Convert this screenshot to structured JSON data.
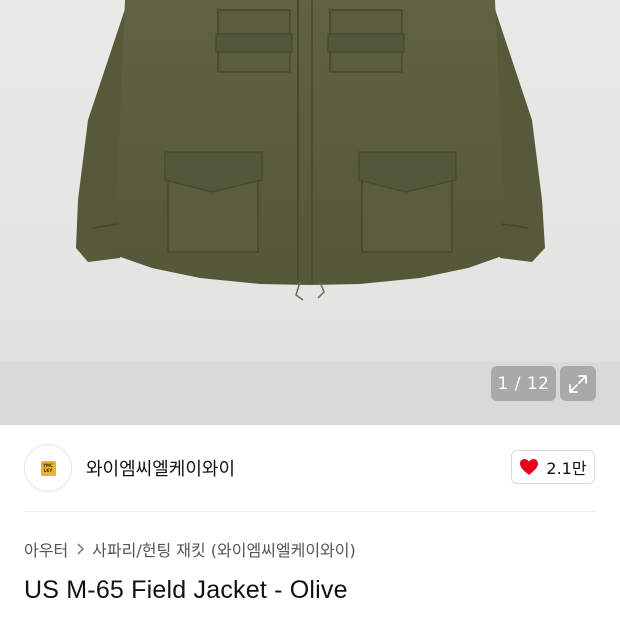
{
  "gallery": {
    "counter_text": "1 / 12",
    "expand_icon": "expand-icon",
    "jacket_color": "#5c5f3e"
  },
  "brand": {
    "name": "와이엠씨엘케이와이",
    "logo_text_line1": "YMC",
    "logo_text_line2": "LKY"
  },
  "like": {
    "icon": "heart-icon",
    "count": "2.1만",
    "color": "#e8001c"
  },
  "breadcrumb": {
    "category": "아우터",
    "subcategory": "사파리/헌팅 재킷 (와이엠씨엘케이와이)"
  },
  "product": {
    "title": "US M-65 Field Jacket - Olive"
  }
}
